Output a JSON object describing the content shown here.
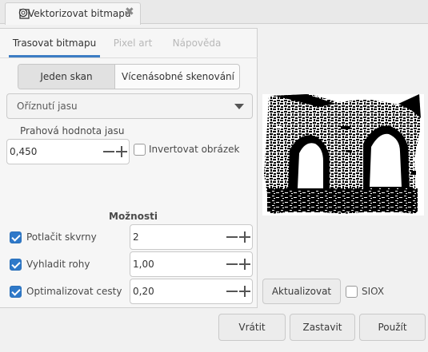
{
  "dock_tab": {
    "title": "Vektorizovat bitmapu",
    "icon": "trace-bitmap-icon",
    "close_icon": "close-icon"
  },
  "notebook_tabs": [
    {
      "label": "Trasovat bitmapu",
      "active": true
    },
    {
      "label": "Pixel art",
      "active": false
    },
    {
      "label": "Nápověda",
      "active": false
    }
  ],
  "scan_mode": {
    "single": "Jeden skan",
    "multi": "Vícenásobné skenování",
    "selected": "single"
  },
  "detection_mode": {
    "value": "Oříznutí jasu"
  },
  "threshold": {
    "label": "Prahová hodnota jasu",
    "value": "0,450"
  },
  "invert": {
    "label": "Invertovat obrázek",
    "checked": false
  },
  "options": {
    "heading": "Možnosti",
    "speckles": {
      "label": "Potlačit skvrny",
      "checked": true,
      "value": "2"
    },
    "corners": {
      "label": "Vyhladit rohy",
      "checked": true,
      "value": "1,00"
    },
    "paths": {
      "label": "Optimalizovat cesty",
      "checked": true,
      "value": "0,20"
    }
  },
  "preview": {
    "update_label": "Aktualizovat",
    "siox_label": "SIOX",
    "siox_checked": false
  },
  "actions": {
    "reset": "Vrátit",
    "stop": "Zastavit",
    "apply": "Použít"
  },
  "colors": {
    "accent": "#3c7dc4",
    "checkbox": "#2f79c9"
  }
}
